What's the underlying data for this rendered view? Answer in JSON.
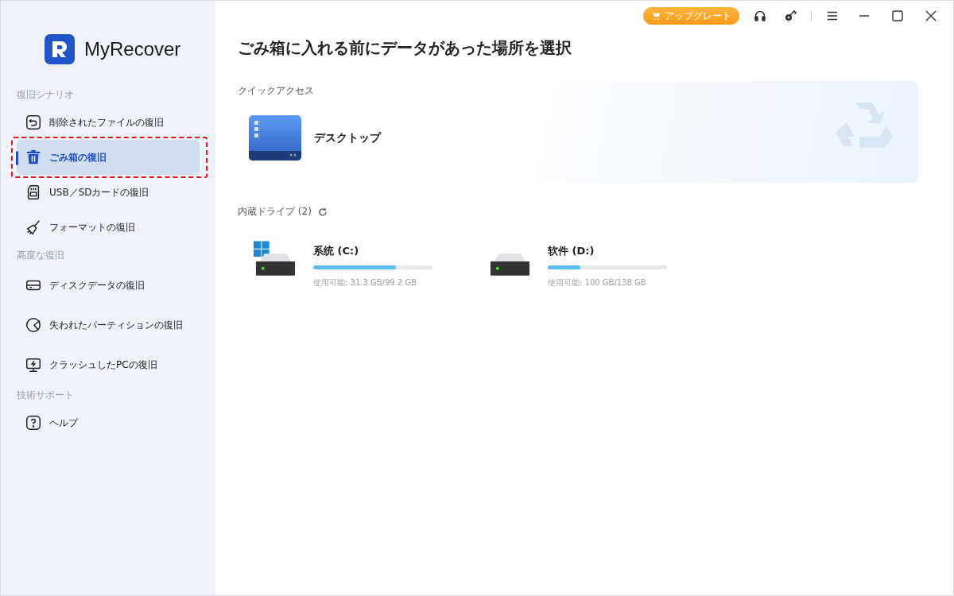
{
  "app": {
    "name": "MyRecover"
  },
  "sidebar": {
    "sections": [
      {
        "title": "復旧シナリオ",
        "items": [
          {
            "label": "削除されたファイルの復旧",
            "selected": false,
            "highlighted": false
          },
          {
            "label": "ごみ箱の復旧",
            "selected": true,
            "highlighted": true
          },
          {
            "label": "USB／SDカードの復旧",
            "selected": false,
            "highlighted": false
          },
          {
            "label": "フォーマットの復旧",
            "selected": false,
            "highlighted": false
          }
        ]
      },
      {
        "title": "高度な復旧",
        "items": [
          {
            "label": "ディスクデータの復旧",
            "selected": false,
            "highlighted": false
          },
          {
            "label": "失われたパーティションの復旧",
            "selected": false,
            "highlighted": false
          },
          {
            "label": "クラッシュしたPCの復旧",
            "selected": false,
            "highlighted": false
          }
        ]
      },
      {
        "title": "技術サポート",
        "items": [
          {
            "label": "ヘルプ",
            "selected": false,
            "highlighted": false
          }
        ]
      }
    ]
  },
  "title_bar": {
    "upgrade_button": "アップグレート"
  },
  "page_title": "ごみ箱に入れる前にデータがあった場所を選択",
  "quick_access": {
    "title": "クイックアクセス",
    "items": [
      {
        "label": "デスクトップ"
      }
    ]
  },
  "drives": {
    "title": "内蔵ドライブ (2)",
    "items": [
      {
        "name": "系统 (C:)",
        "system": true,
        "level": 0.69,
        "usage": "使用可能: 31.3 GB/99.2 GB"
      },
      {
        "name": "软件 (D:)",
        "system": false,
        "level": 0.27,
        "usage": "使用可能: 100 GB/138 GB"
      }
    ]
  }
}
